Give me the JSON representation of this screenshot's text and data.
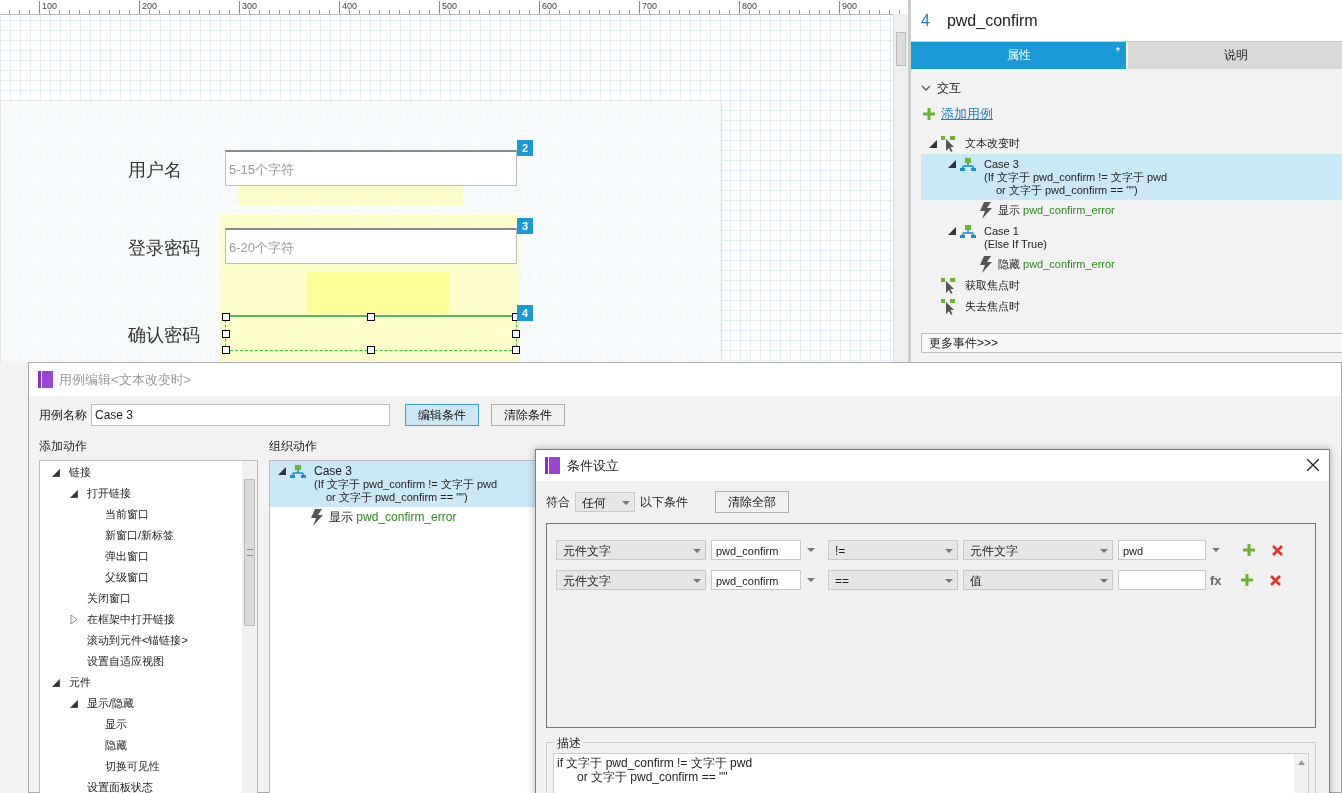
{
  "canvas": {
    "ruler_ticks": [
      "100",
      "200",
      "300",
      "400",
      "500",
      "600",
      "700",
      "800",
      "900"
    ],
    "fields": [
      {
        "label": "用户名",
        "placeholder": "5-15个字符",
        "badge": "2",
        "selected": false
      },
      {
        "label": "登录密码",
        "placeholder": "6-20个字符",
        "badge": "3",
        "selected": false
      },
      {
        "label": "确认密码",
        "badge": "4",
        "selected": true
      }
    ]
  },
  "properties_panel": {
    "number": "4",
    "name": "pwd_confirm",
    "tabs": [
      {
        "label": "属性",
        "mark": "*",
        "selected": true
      },
      {
        "label": "说明",
        "selected": false
      }
    ],
    "section": {
      "title": "交互",
      "expanded": true
    },
    "add_case": "添加用例",
    "events": [
      {
        "label": "文本改变时",
        "cases": [
          {
            "name": "Case 3",
            "condition": [
              "(If 文字于 pwd_confirm != 文字于 pwd",
              "or 文字于 pwd_confirm == \"\")"
            ],
            "selected": true,
            "actions": [
              {
                "verb": "显示",
                "target": "pwd_confirm_error"
              }
            ]
          },
          {
            "name": "Case 1",
            "condition": [
              "(Else If True)"
            ],
            "selected": false,
            "actions": [
              {
                "verb": "隐藏",
                "target": "pwd_confirm_error"
              }
            ]
          }
        ]
      },
      {
        "label": "获取焦点时"
      },
      {
        "label": "失去焦点时"
      }
    ],
    "more_events": "更多事件>>>"
  },
  "case_editor": {
    "title": "用例编辑<文本改变时>",
    "name_label": "用例名称",
    "name_value": "Case 3",
    "buttons": [
      {
        "label": "编辑条件",
        "selected": true
      },
      {
        "label": "清除条件",
        "selected": false
      }
    ],
    "add_actions": {
      "heading": "添加动作",
      "tree": [
        {
          "label": "链接",
          "expanded": true,
          "children": [
            {
              "label": "打开链接",
              "expanded": true,
              "children": [
                {
                  "label": "当前窗口"
                },
                {
                  "label": "新窗口/新标签"
                },
                {
                  "label": "弹出窗口"
                },
                {
                  "label": "父级窗口"
                }
              ]
            },
            {
              "label": "关闭窗口"
            },
            {
              "label": "在框架中打开链接",
              "expanded": false
            },
            {
              "label": "滚动到元件<锚链接>"
            },
            {
              "label": "设置自适应视图"
            }
          ]
        },
        {
          "label": "元件",
          "expanded": true,
          "children": [
            {
              "label": "显示/隐藏",
              "expanded": true,
              "children": [
                {
                  "label": "显示"
                },
                {
                  "label": "隐藏"
                },
                {
                  "label": "切换可见性"
                }
              ]
            },
            {
              "label": "设置面板状态"
            }
          ]
        }
      ]
    },
    "organize": {
      "heading": "组织动作",
      "cases": [
        {
          "name": "Case 3",
          "condition": [
            "(If 文字于 pwd_confirm != 文字于 pwd",
            "or 文字于 pwd_confirm == \"\")"
          ],
          "selected": true,
          "actions": [
            {
              "verb": "显示",
              "target": "pwd_confirm_error"
            }
          ]
        }
      ]
    }
  },
  "condition_dialog": {
    "title": "条件设立",
    "match_label": "符合",
    "match_value": "任何",
    "match_suffix": "以下条件",
    "clear_all": "清除全部",
    "rows": [
      {
        "source": "元件文字",
        "widget": "pwd_confirm",
        "operator": "!=",
        "target_type": "元件文字",
        "target": "pwd"
      },
      {
        "source": "元件文字",
        "widget": "pwd_confirm",
        "operator": "==",
        "target_type": "值",
        "fx": "fx"
      }
    ],
    "description": {
      "label": "描述",
      "lines": [
        "if 文字于 pwd_confirm != 文字于 pwd",
        "or 文字于 pwd_confirm == \"\""
      ]
    }
  }
}
